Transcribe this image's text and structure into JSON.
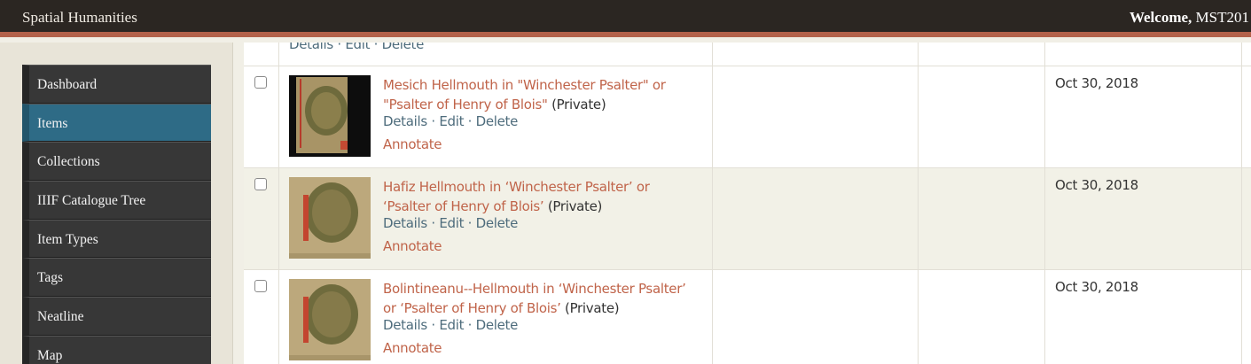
{
  "header": {
    "site_title": "Spatial Humanities",
    "welcome_label": "Welcome,",
    "username": "MST201"
  },
  "colors": {
    "topbar": "#2b2622",
    "accent_stripe": "#b3614a",
    "nav_item": "#373737",
    "nav_active": "#2e6b86",
    "link_title": "#c0644a",
    "link_action": "#4e6c7c"
  },
  "sidebar": {
    "items": [
      {
        "label": "Dashboard",
        "active": false
      },
      {
        "label": "Items",
        "active": true
      },
      {
        "label": "Collections",
        "active": false
      },
      {
        "label": "IIIF Catalogue Tree",
        "active": false
      },
      {
        "label": "Item Types",
        "active": false
      },
      {
        "label": "Tags",
        "active": false
      },
      {
        "label": "Neatline",
        "active": false
      },
      {
        "label": "Map",
        "active": false
      }
    ]
  },
  "actions": {
    "details": "Details",
    "edit": "Edit",
    "delete": "Delete",
    "separator": "·",
    "annotate": "Annotate"
  },
  "items": [
    {
      "title_line1": "Mesich Hellmouth in \"Winchester Psalter\" or",
      "title_line2": "\"Psalter of Henry of Blois\"",
      "visibility": "(Private)",
      "date": "Oct 30, 2018"
    },
    {
      "title_line1": "Hafiz Hellmouth in ‘Winchester Psalter’ or",
      "title_line2": "‘Psalter of Henry of Blois’",
      "visibility": "(Private)",
      "date": "Oct 30, 2018"
    },
    {
      "title_line1": "Bolintineanu--Hellmouth in ‘Winchester Psalter’",
      "title_line2": "or ‘Psalter of Henry of Blois’",
      "visibility": "(Private)",
      "date": "Oct 30, 2018"
    }
  ]
}
